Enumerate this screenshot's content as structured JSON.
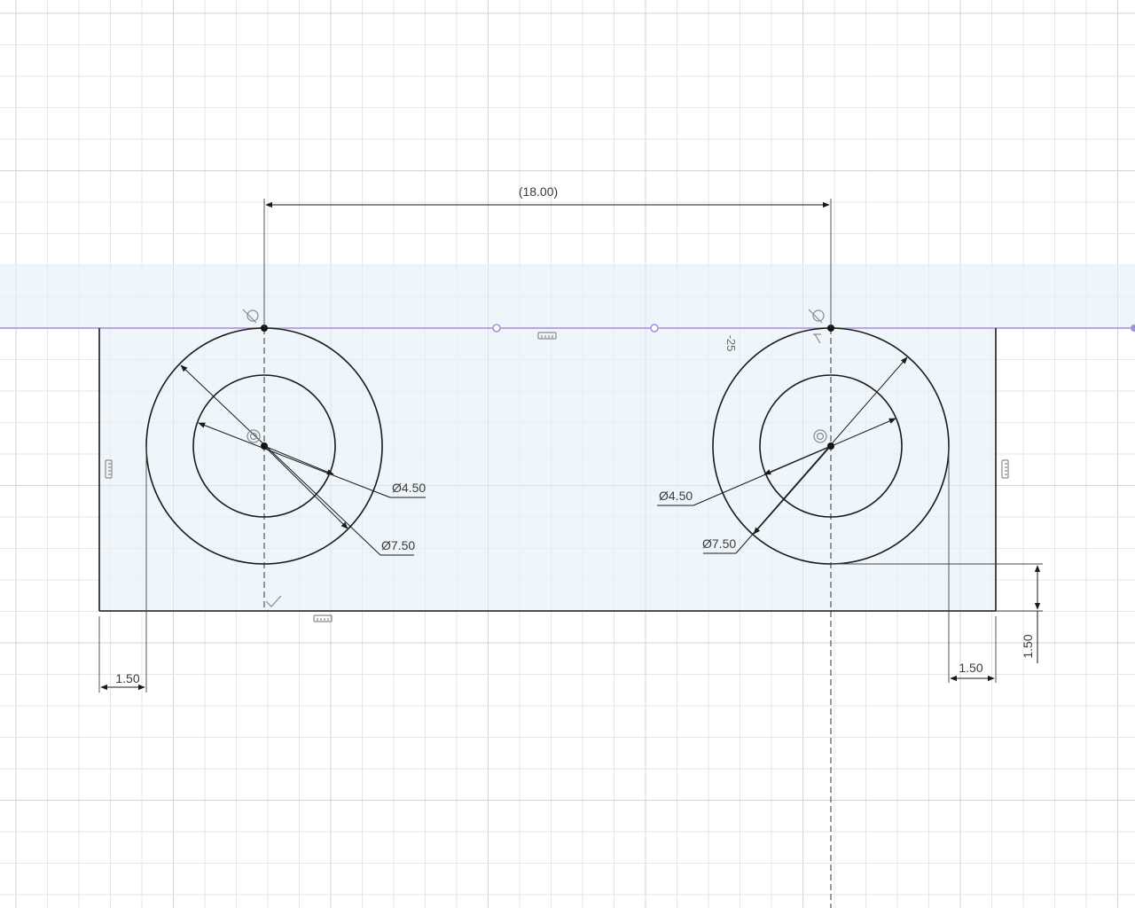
{
  "viewport": {
    "background": "#ffffff",
    "grid_color": "#e6e6e6",
    "profile_fill": "#eef6fb",
    "construction_color": "#a98bdb"
  },
  "dimensions": {
    "center_distance": "(18.00)",
    "hole_left_inner": "Ø4.50",
    "hole_left_outer": "Ø7.50",
    "hole_right_inner": "Ø4.50",
    "hole_right_outer": "Ø7.50",
    "left_edge_offset": "1.50",
    "right_edge_offset": "1.50",
    "bottom_edge_offset": "1.50",
    "axis_tick_label": "-25"
  },
  "constraint_icons": {
    "left_top": "tangent-icon",
    "right_top": "tangent-icon",
    "left_center": "concentric-icon",
    "right_center": "concentric-icon",
    "left_edge": "vertical-icon",
    "right_edge": "vertical-icon",
    "top_edge": "horizontal-icon",
    "bottom_edge": "horizontal-icon",
    "bottom_coincident": "perpendicular-icon"
  }
}
